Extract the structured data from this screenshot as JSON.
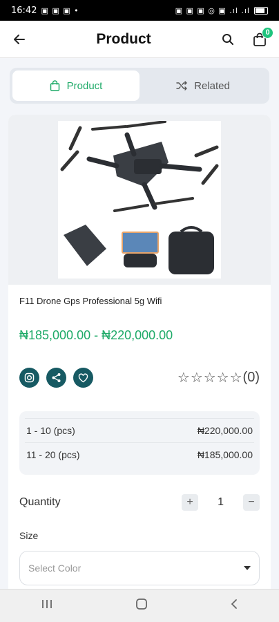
{
  "status": {
    "time": "16:42",
    "notif_icons": "▣ ▣ ▣ •",
    "sys_icons": "▣ ▣ ▣ ◎ ▣ .ıl .ıl"
  },
  "appbar": {
    "title": "Product",
    "cart_count": "0"
  },
  "tabs": [
    {
      "label": "Product"
    },
    {
      "label": "Related"
    }
  ],
  "product": {
    "name": "F11 Drone Gps Professional 5g Wifi",
    "price": "₦185,000.00 - ₦220,000.00",
    "rating_stars": "☆☆☆☆☆",
    "rating_count": "(0)"
  },
  "price_tiers": [
    {
      "range": "1 - 10 (pcs)",
      "price": "₦220,000.00"
    },
    {
      "range": "11 - 20 (pcs)",
      "price": "₦185,000.00"
    }
  ],
  "quantity": {
    "label": "Quantity",
    "value": "1",
    "plus": "+",
    "minus": "−"
  },
  "size": {
    "label": "Size",
    "placeholder": "Select Color"
  },
  "colors": {
    "accent": "#1eaa68",
    "badge": "#1ec47d",
    "action_circle": "#175a63"
  }
}
